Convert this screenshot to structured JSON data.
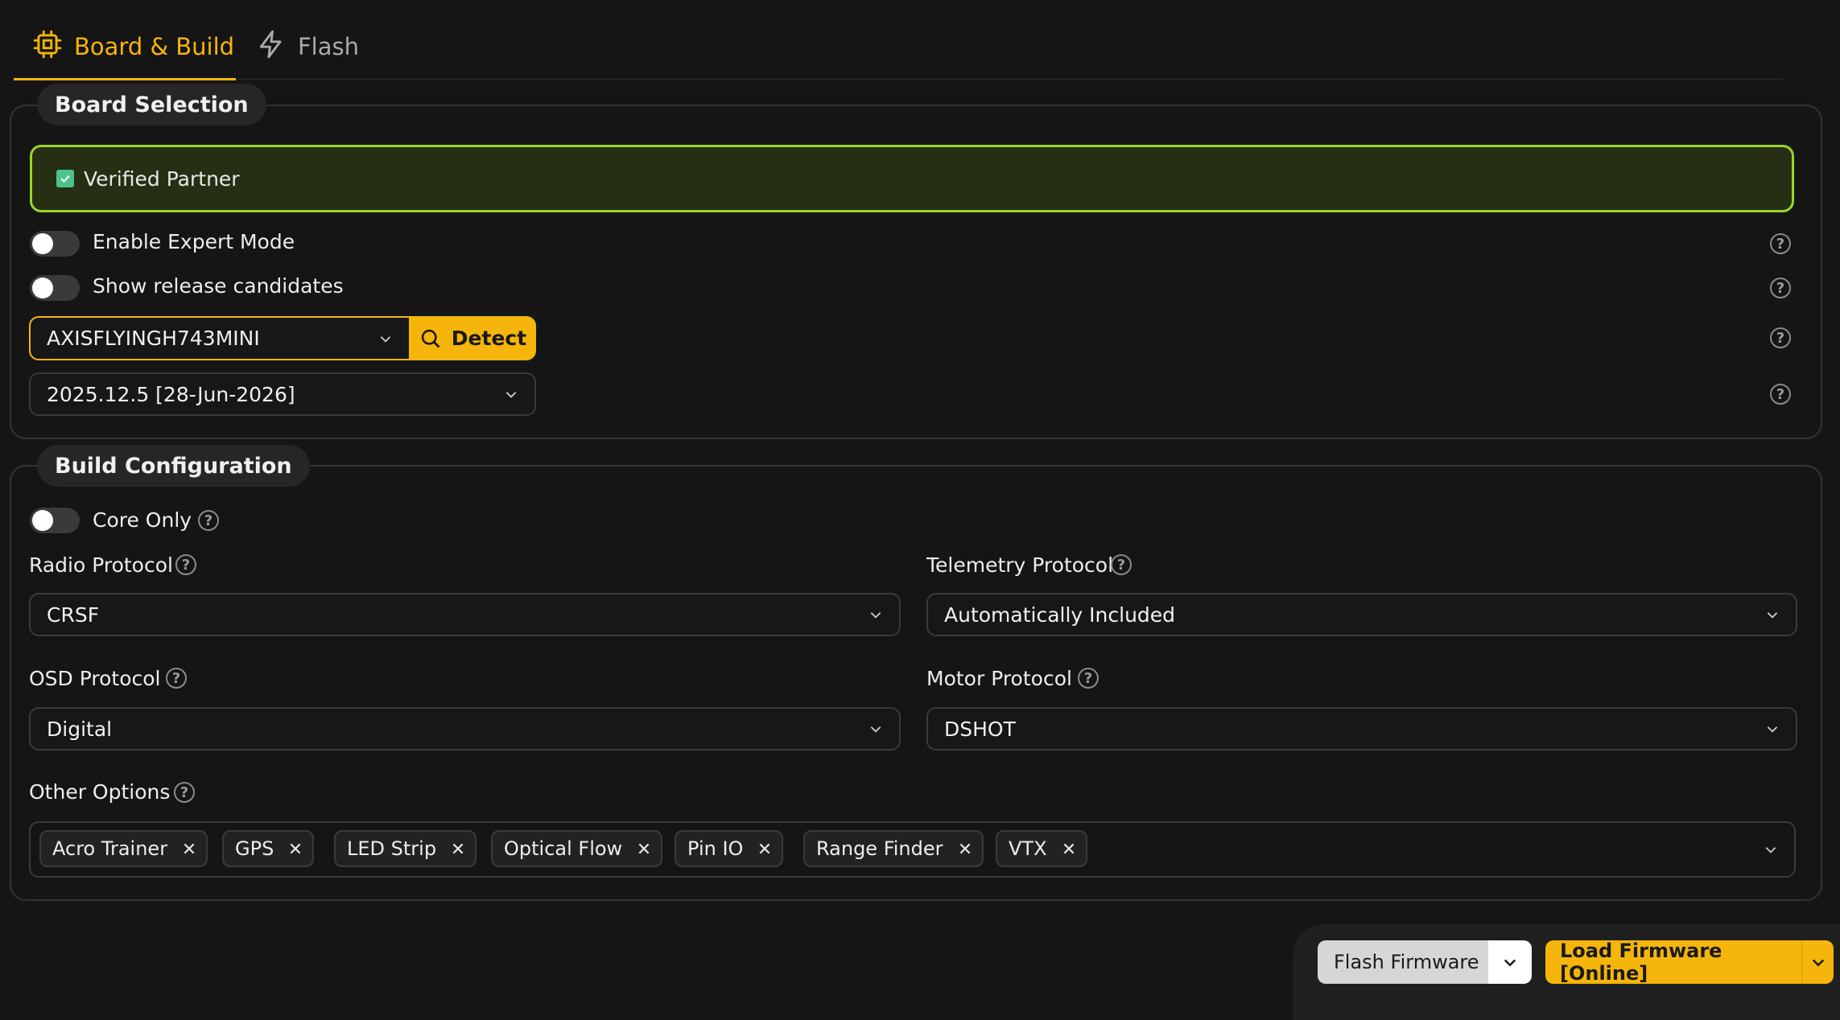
{
  "tabs": [
    {
      "label": "Board & Build",
      "icon": "chip-icon",
      "active": true
    },
    {
      "label": "Flash",
      "icon": "lightning-icon",
      "active": false
    }
  ],
  "board_selection": {
    "legend": "Board Selection",
    "verified_label": "Verified Partner",
    "expert_mode_label": "Enable Expert Mode",
    "release_candidates_label": "Show release candidates",
    "board_value": "AXISFLYINGH743MINI",
    "detect_label": "Detect",
    "version_value": "2025.12.5 [28-Jun-2026]"
  },
  "build_configuration": {
    "legend": "Build Configuration",
    "core_only_label": "Core Only",
    "radio_protocol_label": "Radio Protocol",
    "radio_protocol_value": "CRSF",
    "telemetry_protocol_label": "Telemetry Protocol",
    "telemetry_protocol_value": "Automatically Included",
    "osd_protocol_label": "OSD Protocol",
    "osd_protocol_value": "Digital",
    "motor_protocol_label": "Motor Protocol",
    "motor_protocol_value": "DSHOT",
    "other_options_label": "Other Options",
    "other_options": [
      "Acro Trainer",
      "GPS",
      "LED Strip",
      "Optical Flow",
      "Pin IO",
      "Range Finder",
      "VTX"
    ]
  },
  "actions": {
    "flash_firmware": "Flash Firmware",
    "load_firmware": "Load Firmware [Online]"
  },
  "help_symbol": "?",
  "colors": {
    "accent": "#f5b50a",
    "verified_border": "#9ad52a",
    "verified_bg": "#262f13",
    "background": "#151515"
  }
}
